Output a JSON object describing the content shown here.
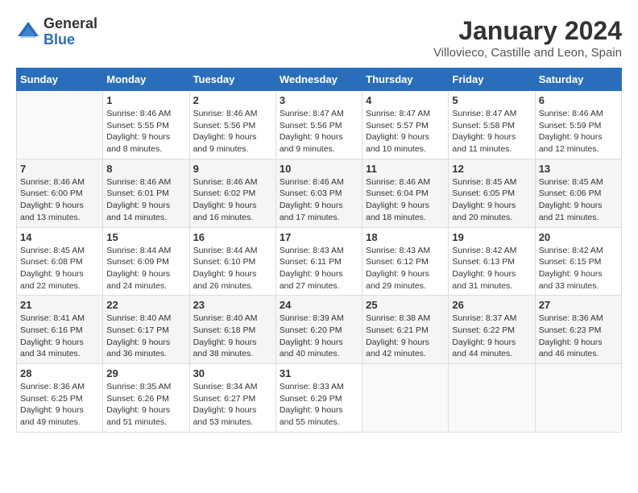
{
  "header": {
    "logo_general": "General",
    "logo_blue": "Blue",
    "month_title": "January 2024",
    "location": "Villovieco, Castille and Leon, Spain"
  },
  "calendar": {
    "days_of_week": [
      "Sunday",
      "Monday",
      "Tuesday",
      "Wednesday",
      "Thursday",
      "Friday",
      "Saturday"
    ],
    "weeks": [
      [
        {
          "day": "",
          "info": ""
        },
        {
          "day": "1",
          "info": "Sunrise: 8:46 AM\nSunset: 5:55 PM\nDaylight: 9 hours\nand 8 minutes."
        },
        {
          "day": "2",
          "info": "Sunrise: 8:46 AM\nSunset: 5:56 PM\nDaylight: 9 hours\nand 9 minutes."
        },
        {
          "day": "3",
          "info": "Sunrise: 8:47 AM\nSunset: 5:56 PM\nDaylight: 9 hours\nand 9 minutes."
        },
        {
          "day": "4",
          "info": "Sunrise: 8:47 AM\nSunset: 5:57 PM\nDaylight: 9 hours\nand 10 minutes."
        },
        {
          "day": "5",
          "info": "Sunrise: 8:47 AM\nSunset: 5:58 PM\nDaylight: 9 hours\nand 11 minutes."
        },
        {
          "day": "6",
          "info": "Sunrise: 8:46 AM\nSunset: 5:59 PM\nDaylight: 9 hours\nand 12 minutes."
        }
      ],
      [
        {
          "day": "7",
          "info": "Sunrise: 8:46 AM\nSunset: 6:00 PM\nDaylight: 9 hours\nand 13 minutes."
        },
        {
          "day": "8",
          "info": "Sunrise: 8:46 AM\nSunset: 6:01 PM\nDaylight: 9 hours\nand 14 minutes."
        },
        {
          "day": "9",
          "info": "Sunrise: 8:46 AM\nSunset: 6:02 PM\nDaylight: 9 hours\nand 16 minutes."
        },
        {
          "day": "10",
          "info": "Sunrise: 8:46 AM\nSunset: 6:03 PM\nDaylight: 9 hours\nand 17 minutes."
        },
        {
          "day": "11",
          "info": "Sunrise: 8:46 AM\nSunset: 6:04 PM\nDaylight: 9 hours\nand 18 minutes."
        },
        {
          "day": "12",
          "info": "Sunrise: 8:45 AM\nSunset: 6:05 PM\nDaylight: 9 hours\nand 20 minutes."
        },
        {
          "day": "13",
          "info": "Sunrise: 8:45 AM\nSunset: 6:06 PM\nDaylight: 9 hours\nand 21 minutes."
        }
      ],
      [
        {
          "day": "14",
          "info": "Sunrise: 8:45 AM\nSunset: 6:08 PM\nDaylight: 9 hours\nand 22 minutes."
        },
        {
          "day": "15",
          "info": "Sunrise: 8:44 AM\nSunset: 6:09 PM\nDaylight: 9 hours\nand 24 minutes."
        },
        {
          "day": "16",
          "info": "Sunrise: 8:44 AM\nSunset: 6:10 PM\nDaylight: 9 hours\nand 26 minutes."
        },
        {
          "day": "17",
          "info": "Sunrise: 8:43 AM\nSunset: 6:11 PM\nDaylight: 9 hours\nand 27 minutes."
        },
        {
          "day": "18",
          "info": "Sunrise: 8:43 AM\nSunset: 6:12 PM\nDaylight: 9 hours\nand 29 minutes."
        },
        {
          "day": "19",
          "info": "Sunrise: 8:42 AM\nSunset: 6:13 PM\nDaylight: 9 hours\nand 31 minutes."
        },
        {
          "day": "20",
          "info": "Sunrise: 8:42 AM\nSunset: 6:15 PM\nDaylight: 9 hours\nand 33 minutes."
        }
      ],
      [
        {
          "day": "21",
          "info": "Sunrise: 8:41 AM\nSunset: 6:16 PM\nDaylight: 9 hours\nand 34 minutes."
        },
        {
          "day": "22",
          "info": "Sunrise: 8:40 AM\nSunset: 6:17 PM\nDaylight: 9 hours\nand 36 minutes."
        },
        {
          "day": "23",
          "info": "Sunrise: 8:40 AM\nSunset: 6:18 PM\nDaylight: 9 hours\nand 38 minutes."
        },
        {
          "day": "24",
          "info": "Sunrise: 8:39 AM\nSunset: 6:20 PM\nDaylight: 9 hours\nand 40 minutes."
        },
        {
          "day": "25",
          "info": "Sunrise: 8:38 AM\nSunset: 6:21 PM\nDaylight: 9 hours\nand 42 minutes."
        },
        {
          "day": "26",
          "info": "Sunrise: 8:37 AM\nSunset: 6:22 PM\nDaylight: 9 hours\nand 44 minutes."
        },
        {
          "day": "27",
          "info": "Sunrise: 8:36 AM\nSunset: 6:23 PM\nDaylight: 9 hours\nand 46 minutes."
        }
      ],
      [
        {
          "day": "28",
          "info": "Sunrise: 8:36 AM\nSunset: 6:25 PM\nDaylight: 9 hours\nand 49 minutes."
        },
        {
          "day": "29",
          "info": "Sunrise: 8:35 AM\nSunset: 6:26 PM\nDaylight: 9 hours\nand 51 minutes."
        },
        {
          "day": "30",
          "info": "Sunrise: 8:34 AM\nSunset: 6:27 PM\nDaylight: 9 hours\nand 53 minutes."
        },
        {
          "day": "31",
          "info": "Sunrise: 8:33 AM\nSunset: 6:29 PM\nDaylight: 9 hours\nand 55 minutes."
        },
        {
          "day": "",
          "info": ""
        },
        {
          "day": "",
          "info": ""
        },
        {
          "day": "",
          "info": ""
        }
      ]
    ]
  }
}
